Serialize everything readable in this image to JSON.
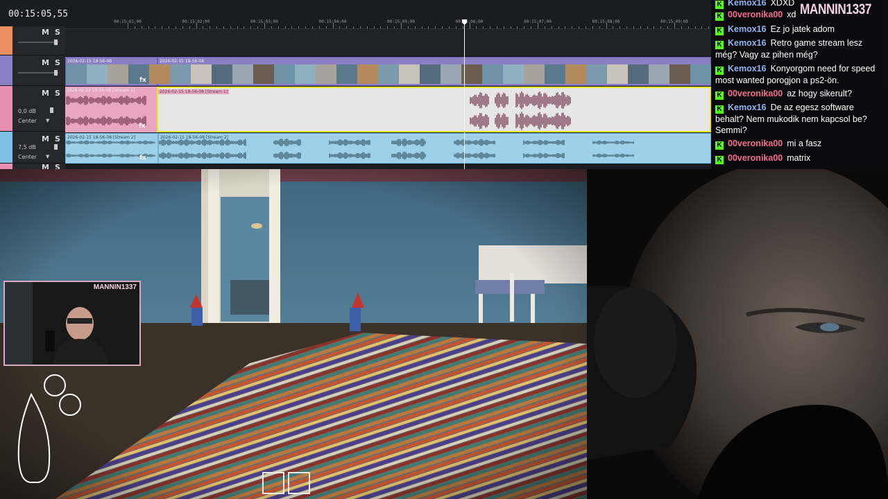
{
  "editor": {
    "timecode": "00:15:05,55",
    "ruler_labels": [
      "00:15:01;00",
      "00:15:02;00",
      "00:15:03;00",
      "00:15:04;00",
      "00:15:05;00",
      "00:15:06;00",
      "00:15:07;00",
      "00:15:08;00",
      "00:15:09;00"
    ],
    "tracks": [
      {
        "mute": "M",
        "solo": "S"
      },
      {
        "mute": "M",
        "solo": "S"
      },
      {
        "mute": "M",
        "solo": "S",
        "volume": "0,0 dB",
        "pan": "Center"
      },
      {
        "mute": "M",
        "solo": "S",
        "volume": "7,5 dB",
        "pan": "Center"
      },
      {
        "mute": "M",
        "solo": "S"
      }
    ],
    "video_clips": [
      "2026-02-15 18-56-08",
      "2026-02-15 18-56-08"
    ],
    "audio1_clips": [
      "2026-02-15 18-56-08 [Stream 1]",
      "2026-02-15 18-56-08 [Stream 1]"
    ],
    "audio2_clips": [
      "2026-02-15 18-56-08 [Stream 2]",
      "2026-02-15 18-56-08 [Stream 2]"
    ],
    "fx_label": "fx",
    "colors": {
      "track_video": "#8b7fc4",
      "track_audio1": "#e68fb0",
      "track_audio2": "#7cc0e4",
      "selection": "#e7e91e",
      "playhead": "#ffffff"
    }
  },
  "chat": {
    "brand": "MANNIN1337",
    "messages": [
      {
        "user": "Kemox16",
        "user_color": "#8fb6f2",
        "text": "XDXD"
      },
      {
        "user": "00veronika00",
        "user_color": "#f26f8f",
        "text": "xd"
      },
      {
        "user": "Kemox16",
        "user_color": "#8fb6f2",
        "text": "Ez jo jatek adom"
      },
      {
        "user": "Kemox16",
        "user_color": "#8fb6f2",
        "text": "Retro game stream lesz még? Vagy az pihen még?"
      },
      {
        "user": "Kemox16",
        "user_color": "#8fb6f2",
        "text": "Konyorgom need for speed most wanted porogjon a ps2-ön."
      },
      {
        "user": "00veronika00",
        "user_color": "#f26f8f",
        "text": "az hogy sikerult?"
      },
      {
        "user": "Kemox16",
        "user_color": "#8fb6f2",
        "text": "De az egesz software behalt? Nem mukodik nem kapcsol be? Semmi?"
      },
      {
        "user": "00veronika00",
        "user_color": "#f26f8f",
        "text": "mi a fasz"
      },
      {
        "user": "00veronika00",
        "user_color": "#f26f8f",
        "text": "matrix"
      }
    ]
  },
  "webcam": {
    "pip_brand": "MANNIN1337"
  }
}
